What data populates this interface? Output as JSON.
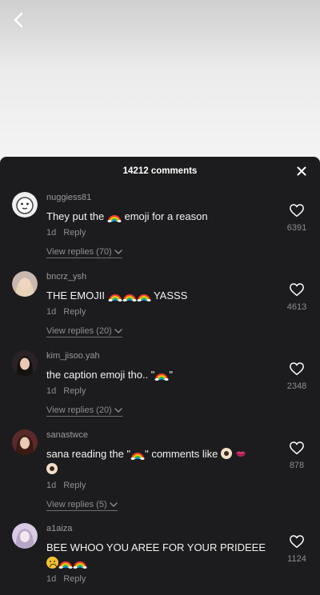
{
  "header": {
    "comments_count_label": "14212 comments"
  },
  "colors": {
    "sheet_bg": "#1c1c1e",
    "text": "#f2f2f2",
    "muted": "#8e8e93"
  },
  "comments": [
    {
      "username": "nuggiess81",
      "text_parts": [
        "They put the ",
        " emoji for a reason"
      ],
      "time": "1d",
      "reply_label": "Reply",
      "view_replies": "View replies (70)",
      "likes": "6391"
    },
    {
      "username": "bncrz_ysh",
      "text_parts": [
        "THE EMOJII ",
        " YASSS"
      ],
      "time": "1d",
      "reply_label": "Reply",
      "view_replies": "View replies (20)",
      "likes": "4613"
    },
    {
      "username": "kim_jisoo.yah",
      "text_parts": [
        "the caption emoji tho.. \"",
        "\""
      ],
      "time": "1d",
      "reply_label": "Reply",
      "view_replies": "View replies (20)",
      "likes": "2348"
    },
    {
      "username": "sanastwce",
      "text_parts": [
        "sana reading the \"",
        "\" comments like "
      ],
      "time": "1d",
      "reply_label": "Reply",
      "view_replies": "View replies (5)",
      "likes": "878"
    },
    {
      "username": "a1aiza",
      "text_parts": [
        "BEE WHOO YOU AREE FOR YOUR PRIDEEE"
      ],
      "time": "1d",
      "reply_label": "Reply",
      "likes": "1124"
    }
  ]
}
